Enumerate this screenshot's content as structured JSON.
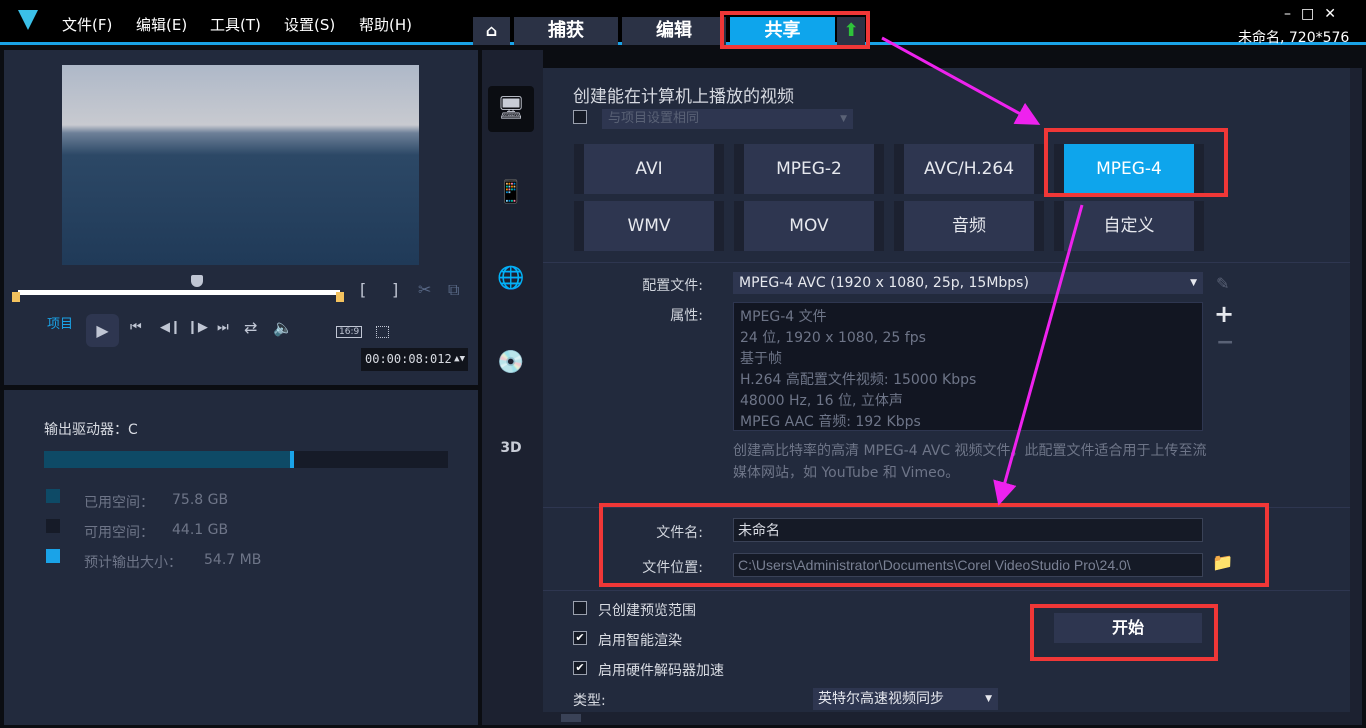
{
  "menu": [
    "文件(F)",
    "编辑(E)",
    "工具(T)",
    "设置(S)",
    "帮助(H)"
  ],
  "tabs": {
    "capture": "捕获",
    "edit": "编辑",
    "share": "共享"
  },
  "project_info": "未命名, 720*576",
  "player": {
    "mode_label": "项目",
    "aspect": "16:9",
    "timecode": "00:00:08:012"
  },
  "storage": {
    "drive_label": "输出驱动器：C",
    "used_fraction": 0.62,
    "used_label": "已用空间：",
    "used_value": "75.8 GB",
    "free_label": "可用空间：",
    "free_value": "44.1 GB",
    "est_label": "预计输出大小：",
    "est_value": "54.7 MB"
  },
  "share": {
    "heading": "创建能在计算机上播放的视频",
    "same_as_project": "与项目设置相同",
    "formats": [
      "AVI",
      "MPEG-2",
      "AVC/H.264",
      "MPEG-4",
      "WMV",
      "MOV",
      "音频",
      "自定义"
    ],
    "selected_format": "MPEG-4",
    "profile_label": "配置文件:",
    "profile_value": "MPEG-4 AVC (1920 x 1080, 25p, 15Mbps)",
    "props_label": "属性:",
    "props": [
      "MPEG-4 文件",
      "24 位, 1920 x 1080, 25 fps",
      "基于帧",
      "H.264 高配置文件视频: 15000 Kbps",
      "48000 Hz, 16 位, 立体声",
      "MPEG AAC 音频: 192 Kbps"
    ],
    "description": "创建高比特率的高清 MPEG-4 AVC 视频文件。此配置文件适合用于上传至流媒体网站，如 YouTube 和 Vimeo。",
    "filename_label": "文件名:",
    "filename_value": "未命名",
    "location_label": "文件位置:",
    "location_value": "C:\\Users\\Administrator\\Documents\\Corel VideoStudio Pro\\24.0\\",
    "opt_preview": "只创建预览范围",
    "opt_smart": "启用智能渲染",
    "opt_hw": "启用硬件解码器加速",
    "type_label": "类型:",
    "type_value": "英特尔高速视频同步",
    "start": "开始"
  },
  "colors": {
    "accent": "#0ea5ec",
    "highlight": "#f03737",
    "arrow": "#ee22ee"
  }
}
